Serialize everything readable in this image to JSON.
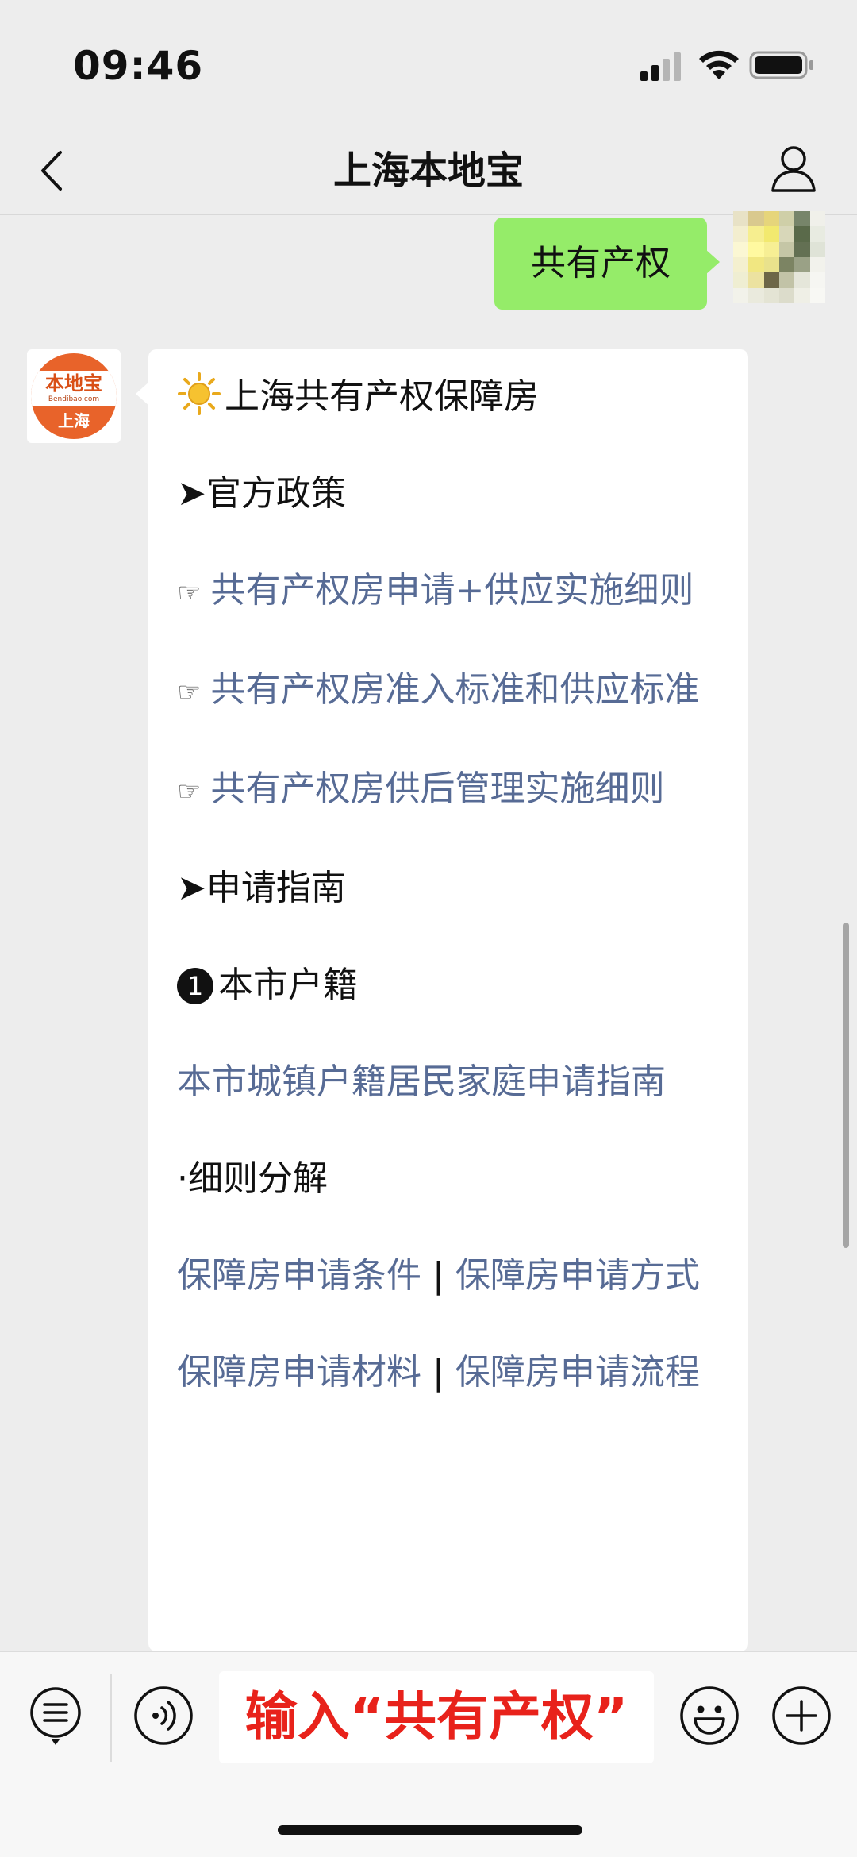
{
  "status_bar": {
    "time": "09:46"
  },
  "nav": {
    "title": "上海本地宝"
  },
  "sent_message": {
    "text": "共有产权"
  },
  "brand_avatar": {
    "logo_text": "本地宝",
    "logo_url": "Bendibao.com",
    "city": "上海"
  },
  "received_message": {
    "title": "上海共有产权保障房",
    "section1": "官方政策",
    "link1": "共有产权房申请+供应实施细则",
    "link2": "共有产权房准入标准和供应标准",
    "link3": "共有产权房供后管理实施细则",
    "section2": "申请指南",
    "num_badge": "1",
    "sub1": "本市户籍",
    "link4": "本市城镇户籍居民家庭申请指南",
    "sub2": "细则分解",
    "link5a": "保障房申请条件",
    "link5b": "保障房申请方式",
    "link6a": "保障房申请材料",
    "link6b": "保障房申请流程",
    "separator": "|"
  },
  "input_bar": {
    "value": "输入“共有产权”"
  },
  "icons": [
    "signal-icon",
    "wifi-icon",
    "battery-icon",
    "back-icon",
    "profile-icon",
    "sun-icon",
    "menu-icon",
    "voice-icon",
    "emoji-icon",
    "plus-icon"
  ],
  "colors": {
    "sent_bubble": "#95ec69",
    "link": "#576b95",
    "input_text": "#e8221b",
    "background": "#ededed"
  }
}
